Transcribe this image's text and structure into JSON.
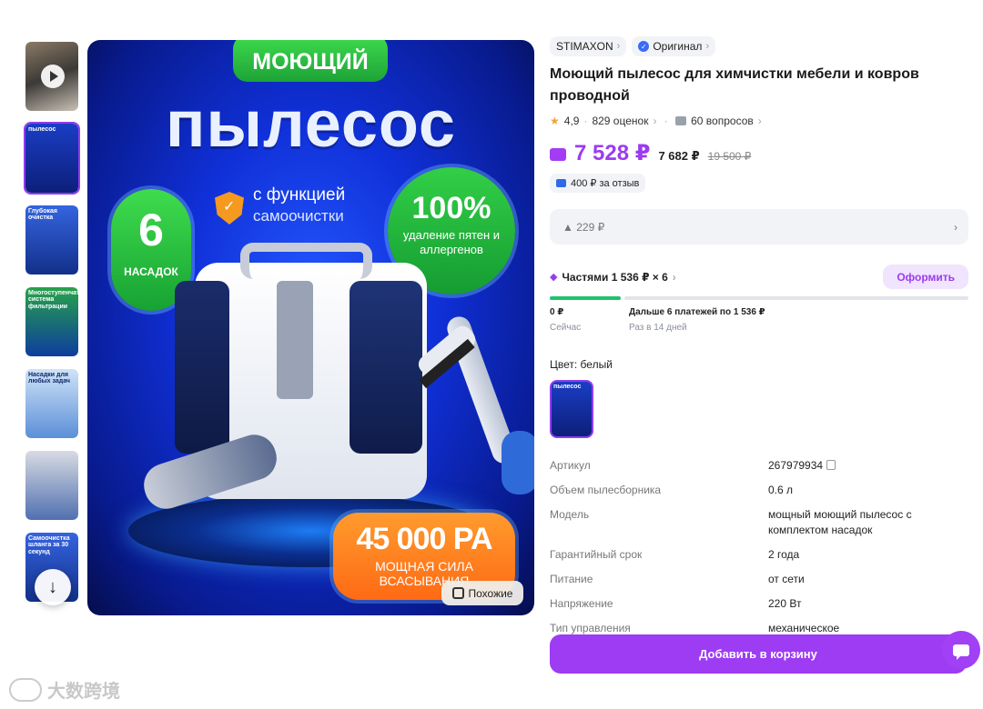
{
  "gallery": {
    "thumbnails": [
      {
        "kind": "video",
        "text": ""
      },
      {
        "kind": "image",
        "text": "пылесос"
      },
      {
        "kind": "image",
        "text": "Глубокая очистка"
      },
      {
        "kind": "image",
        "text": "Многоступенчатая система фильтрации"
      },
      {
        "kind": "image",
        "text": "Насадки для любых задач"
      },
      {
        "kind": "image",
        "text": ""
      },
      {
        "kind": "image",
        "text": "Самоочистка шланга за 30 секунд"
      }
    ],
    "scroll_icon": "arrow-down-icon"
  },
  "hero": {
    "top_label": "МОЮЩИЙ",
    "headline": "пылесос",
    "feature_line1": "с функцией",
    "feature_line2": "самоочистки",
    "nozzles_number": "6",
    "nozzles_label": "НАСАДОК",
    "percent": "100%",
    "percent_label": "удаление пятен и аллергенов",
    "suction_value": "45 000 PA",
    "suction_label": "МОЩНАЯ СИЛА ВСАСЫВАНИЯ",
    "similar_button": "Похожие"
  },
  "product": {
    "brand": "STIMAXON",
    "badge": "Оригинал",
    "title": "Моющий пылесос для химчистки мебели и ковров проводной",
    "rating": "4,9",
    "reviews": "829 оценок",
    "questions": "60 вопросов",
    "price_wallet": "7 528 ₽",
    "price": "7 682 ₽",
    "price_old": "19 500 ₽",
    "review_bonus": "400 ₽ за отзыв",
    "cashback": "229 ₽",
    "installments_label": "Частями 1 536 ₽ × 6",
    "installments_button": "Оформить",
    "now_amount": "0 ₽",
    "now_label": "Сейчас",
    "next_amount": "Дальше 6 платежей по 1 536 ₽",
    "next_label": "Раз в 14 дней",
    "installment_progress": 0.17,
    "color_label": "Цвет: белый",
    "color_swatch_text": "пылесос"
  },
  "specs": [
    {
      "k": "Артикул",
      "v": "267979934"
    },
    {
      "k": "Объем пылесборника",
      "v": "0.6 л"
    },
    {
      "k": "Модель",
      "v": "мощный моющий пылесос с комплектом насадок"
    },
    {
      "k": "Гарантийный срок",
      "v": "2 года"
    },
    {
      "k": "Питание",
      "v": "от сети"
    },
    {
      "k": "Напряжение",
      "v": "220 Вт"
    },
    {
      "k": "Тип управления",
      "v": "механическое"
    }
  ],
  "cart_button": "Добавить в корзину",
  "watermark": "大数跨境",
  "colors": {
    "accent": "#9d3cf3",
    "green": "#1ec36a",
    "star": "#f0a33a"
  }
}
